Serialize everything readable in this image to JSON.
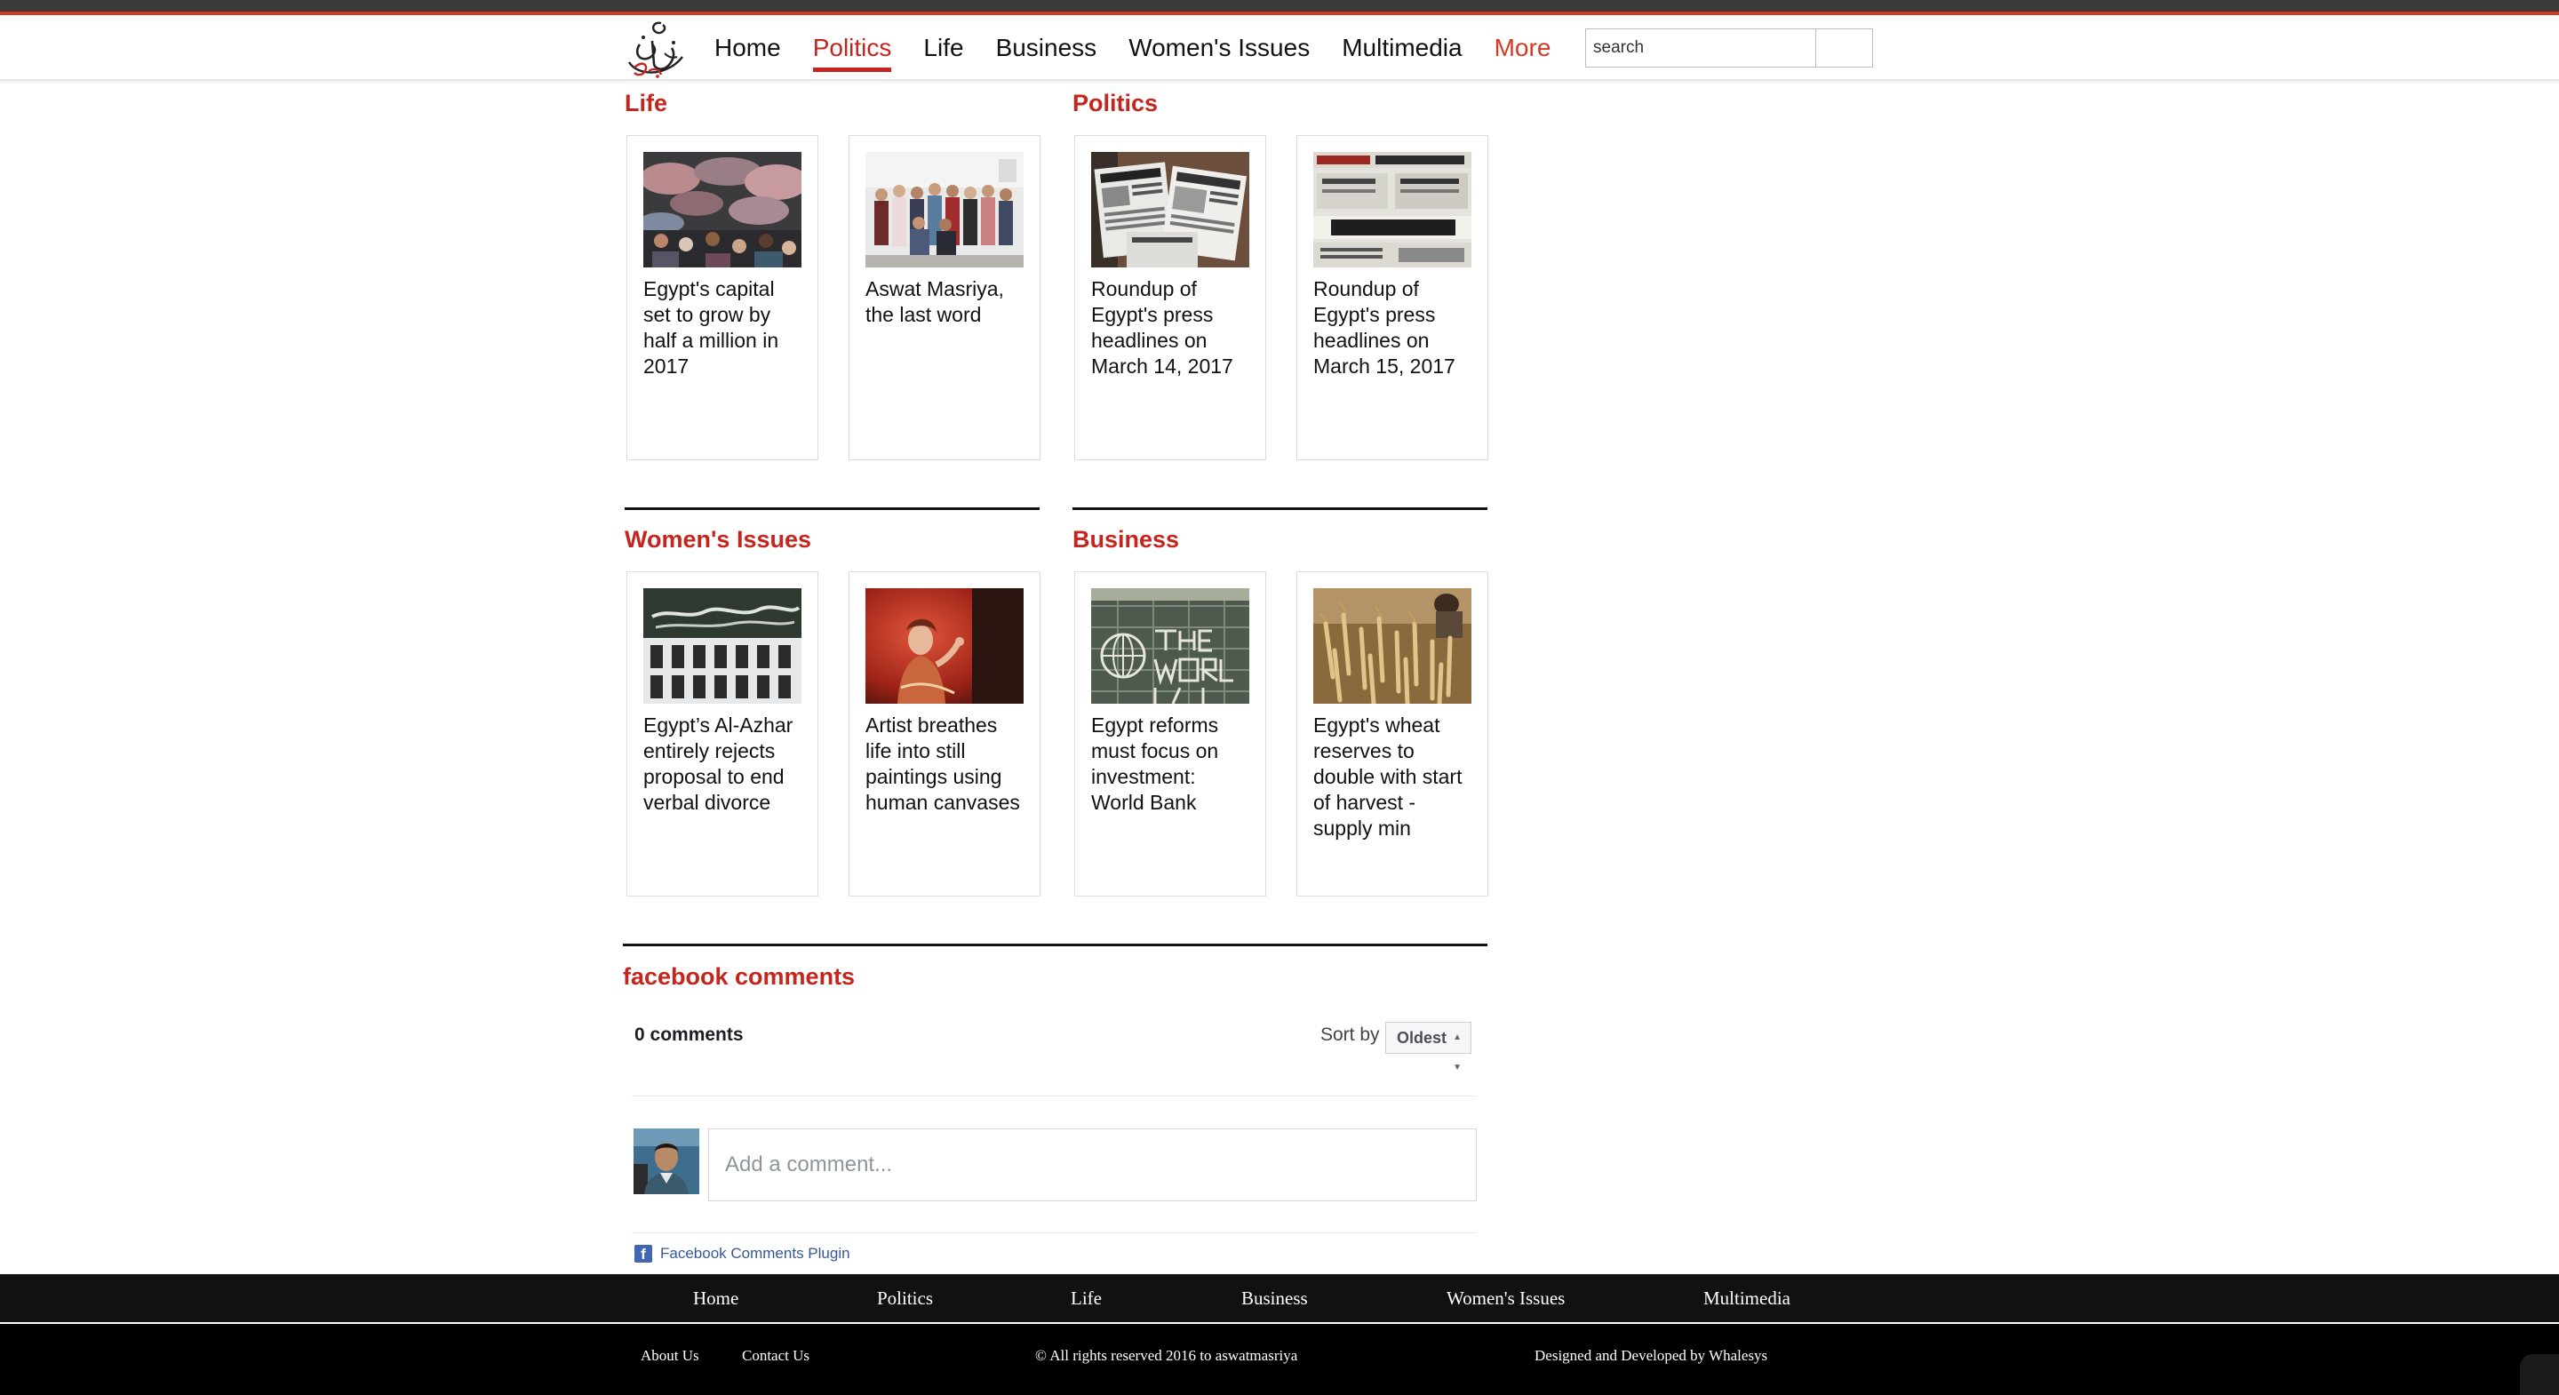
{
  "header": {
    "nav": [
      {
        "label": "Home",
        "active": false
      },
      {
        "label": "Politics",
        "active": true
      },
      {
        "label": "Life",
        "active": false
      },
      {
        "label": "Business",
        "active": false
      },
      {
        "label": "Women's Issues",
        "active": false
      },
      {
        "label": "Multimedia",
        "active": false
      }
    ],
    "more_label": "More",
    "search": {
      "placeholder": "search"
    },
    "logo_icon": "calligraphy-logo",
    "accent_color": "#c4261d"
  },
  "sections": [
    {
      "title": "Life",
      "articles": [
        {
          "title": "Egypt's capital set to grow by half a million in 2017",
          "image": "crowd-market-photo"
        },
        {
          "title": "Aswat Masriya, the last word",
          "image": "group-photo"
        }
      ]
    },
    {
      "title": "Politics",
      "articles": [
        {
          "title": "Roundup of Egypt's press headlines on March 14, 2017",
          "image": "newspapers-photo"
        },
        {
          "title": "Roundup of Egypt's press headlines on March 15, 2017",
          "image": "newspapers-photo"
        }
      ]
    },
    {
      "title": "Women's Issues",
      "articles": [
        {
          "title": "Egypt’s Al-Azhar entirely rejects proposal to end verbal divorce",
          "image": "al-azhar-building-photo"
        },
        {
          "title": "Artist breathes life into still paintings using human canvases",
          "image": "painted-woman-photo"
        }
      ]
    },
    {
      "title": "Business",
      "articles": [
        {
          "title": "Egypt reforms must focus on investment: World Bank",
          "image": "world-bank-photo"
        },
        {
          "title": "Egypt's wheat reserves to double with start of harvest - supply min",
          "image": "wheat-field-photo"
        }
      ]
    }
  ],
  "comments": {
    "heading": "facebook comments",
    "count_label": "0 comments",
    "sort_label": "Sort by",
    "sort_value": "Oldest",
    "placeholder": "Add a comment...",
    "plugin_label": "Facebook Comments Plugin"
  },
  "footer": {
    "nav": [
      "Home",
      "Politics",
      "Life",
      "Business",
      "Women's Issues",
      "Multimedia"
    ],
    "about": "About Us",
    "contact": "Contact Us",
    "copyright": "© All rights reserved 2016 to aswatmasriya",
    "credit": "Designed and Developed by Whalesys"
  }
}
